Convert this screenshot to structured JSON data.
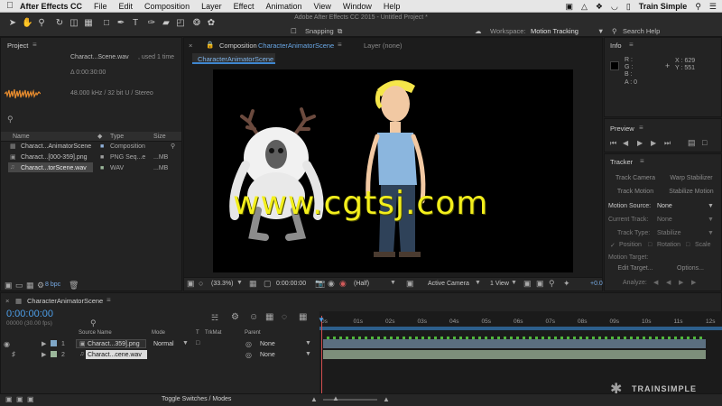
{
  "menubar": {
    "app": "After Effects CC",
    "items": [
      "File",
      "Edit",
      "Composition",
      "Layer",
      "Effect",
      "Animation",
      "View",
      "Window",
      "Help"
    ],
    "brand": "Train Simple"
  },
  "window_title": "Adobe After Effects CC 2015 - Untitled Project *",
  "toolbar": {
    "snapping": "Snapping",
    "workspace_label": "Workspace:",
    "workspace_value": "Motion Tracking",
    "search_help": "Search Help"
  },
  "project": {
    "tab": "Project",
    "preview_name": "Charact...Scene.wav",
    "preview_used": ", used 1 time",
    "preview_duration": "Δ 0:00:30:00",
    "preview_audio": "48.000 kHz / 32 bit U / Stereo",
    "search_placeholder": "",
    "col_name": "Name",
    "col_type": "Type",
    "col_size": "Size",
    "items": [
      {
        "name": "Charact...AnimatorScene",
        "type": "Composition",
        "size": ""
      },
      {
        "name": "Charact...[000-359].png",
        "type": "PNG Seq...e",
        "size": "...MB"
      },
      {
        "name": "Charact...torScene.wav",
        "type": "WAV",
        "size": "...MB"
      }
    ],
    "bpc": "8 bpc"
  },
  "composition": {
    "tab_prefix": "Composition",
    "tab_name": "CharacterAnimatorScene",
    "layer_tab": "Layer (none)",
    "sub_tab": "CharacterAnimatorScene",
    "watermark": "www.cgtsj.com",
    "zoom": "(33.3%)",
    "time": "0:00:00:00",
    "resolution": "(Half)",
    "camera": "Active Camera",
    "views": "1 View",
    "exposure": "+0.0"
  },
  "info": {
    "tab": "Info",
    "r": "R :",
    "g": "G :",
    "b": "B :",
    "a": "A : 0",
    "x": "X : 629",
    "y": "Y : 551"
  },
  "preview": {
    "tab": "Preview"
  },
  "tracker": {
    "tab": "Tracker",
    "track_camera": "Track Camera",
    "warp_stabilizer": "Warp Stabilizer",
    "track_motion": "Track Motion",
    "stabilize_motion": "Stabilize Motion",
    "motion_source_label": "Motion Source:",
    "motion_source_value": "None",
    "current_track_label": "Current Track:",
    "current_track_value": "None",
    "track_type_label": "Track Type:",
    "track_type_value": "Stabilize",
    "position": "Position",
    "rotation": "Rotation",
    "scale": "Scale",
    "motion_target": "Motion Target:",
    "edit_target": "Edit Target...",
    "options": "Options...",
    "analyze": "Analyze:"
  },
  "timeline": {
    "tab": "CharacterAnimatorScene",
    "timecode": "0:00:00:00",
    "fps": "00000 (30.00 fps)",
    "col_source": "Source Name",
    "col_mode": "Mode",
    "col_t": "T",
    "col_trkmat": "TrkMat",
    "col_parent": "Parent",
    "ruler": [
      "0s",
      "01s",
      "02s",
      "03s",
      "04s",
      "05s",
      "06s",
      "07s",
      "08s",
      "09s",
      "10s",
      "11s",
      "12s"
    ],
    "layers": [
      {
        "num": "1",
        "name": "Charact...359].png",
        "mode": "Normal",
        "parent": "None",
        "color": "#7fa7c7"
      },
      {
        "num": "2",
        "name": "Charact...cene.wav",
        "mode": "",
        "parent": "None",
        "color": "#9bb79a"
      }
    ],
    "toggle": "Toggle Switches / Modes"
  },
  "trainsimple_logo": "TRAINSIMPLE"
}
